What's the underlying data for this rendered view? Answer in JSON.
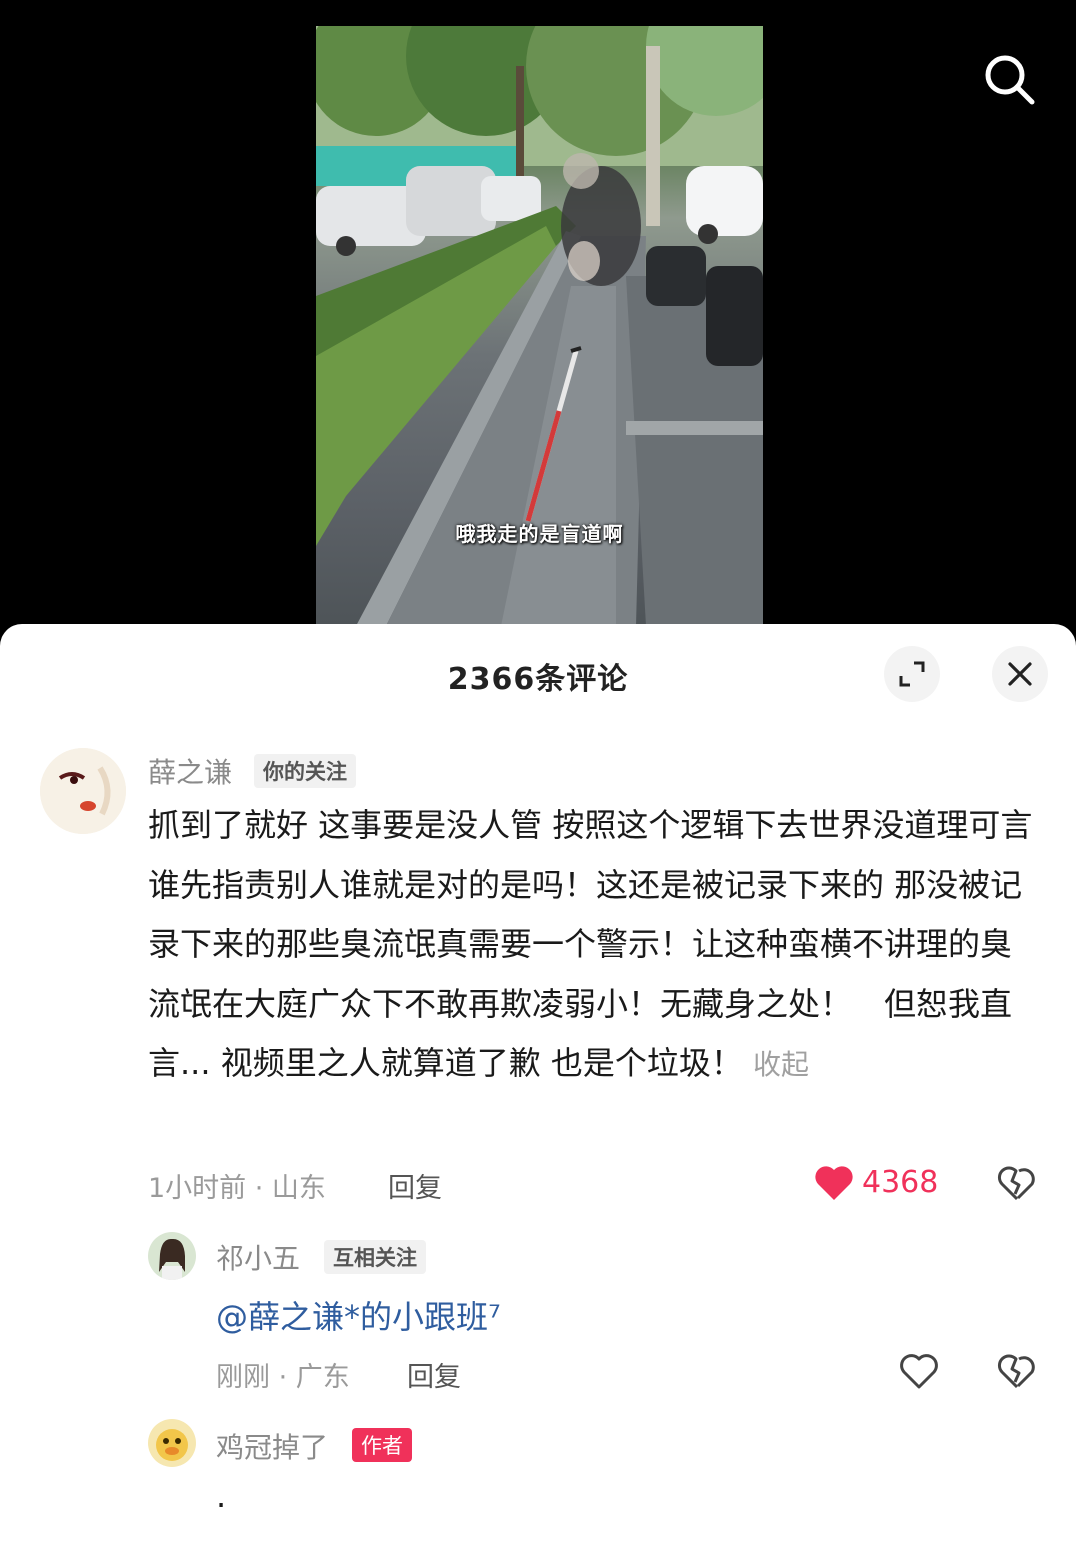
{
  "video": {
    "subtitle": "哦我走的是盲道啊",
    "search_icon": "search-icon"
  },
  "sheet": {
    "title": "2366条评论",
    "expand_icon": "expand-icon",
    "close_icon": "close-icon"
  },
  "comments": [
    {
      "name": "薛之谦",
      "tag": "你的关注",
      "text": "抓到了就好 这事要是没人管 按照这个逻辑下去世界没道理可言 谁先指责别人谁就是对的是吗！这还是被记录下来的 那没被记录下来的那些臭流氓真需要一个警示！让这种蛮横不讲理的臭流氓在大庭广众下不敢再欺凌弱小！无藏身之处！　但恕我直言... 视频里之人就算道了歉 也是个垃圾！",
      "fold": "收起",
      "meta": "1小时前 · 山东",
      "reply": "回复",
      "likes": "4368",
      "liked": true
    },
    {
      "name": "祁小五",
      "tag": "互相关注",
      "mention": "@薛之谦*的小跟班⁷",
      "meta": "刚刚 · 广东",
      "reply": "回复"
    },
    {
      "name": "鸡冠掉了",
      "tag": "作者",
      "text": "."
    }
  ],
  "colors": {
    "accent": "#f0315a",
    "mention": "#2f5d9f"
  }
}
